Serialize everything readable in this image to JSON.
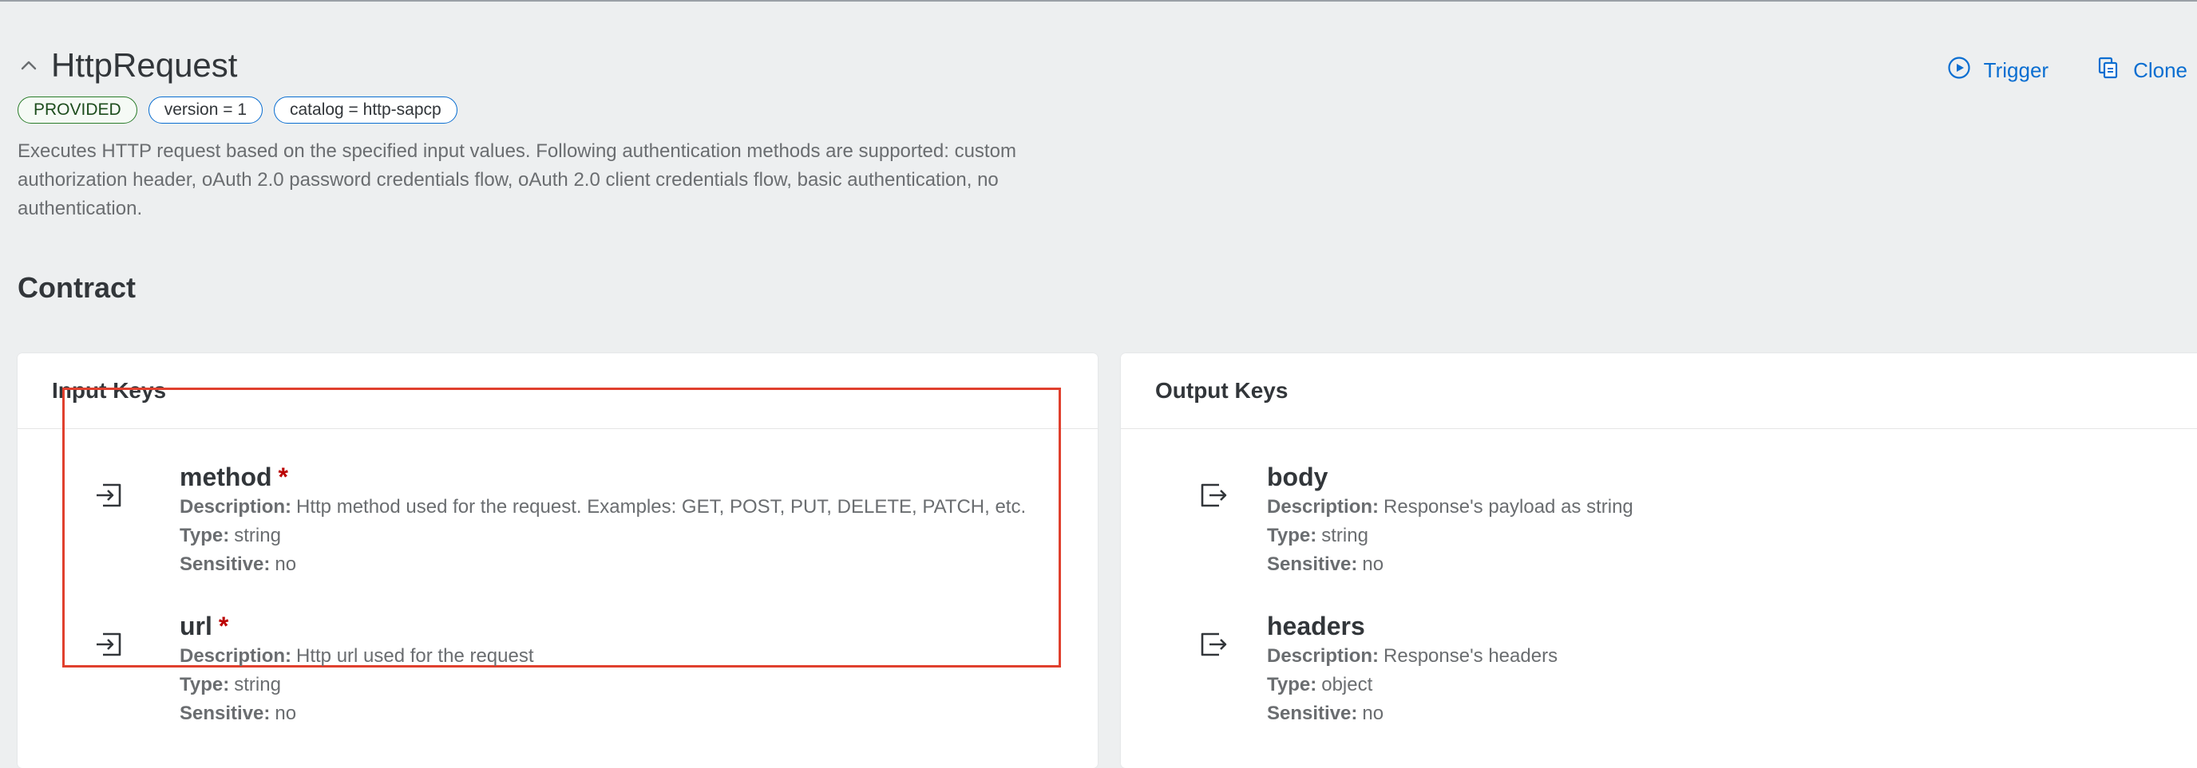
{
  "header": {
    "title": "HttpRequest",
    "badges": {
      "status": "PROVIDED",
      "version": "version = 1",
      "catalog": "catalog = http-sapcp"
    },
    "description": "Executes HTTP request based on the specified input values. Following authentication methods are supported: custom authorization header, oAuth 2.0 password credentials flow, oAuth 2.0 client credentials flow, basic authentication, no authentication."
  },
  "actions": {
    "trigger": "Trigger",
    "clone": "Clone"
  },
  "contract": {
    "title": "Contract",
    "input_title": "Input Keys",
    "output_title": "Output Keys"
  },
  "labels": {
    "description": "Description:",
    "type": "Type:",
    "sensitive": "Sensitive:",
    "required_mark": "*"
  },
  "inputs": [
    {
      "name": "method",
      "description": "Http method used for the request. Examples: GET, POST, PUT, DELETE, PATCH, etc.",
      "type": "string",
      "sensitive": "no"
    },
    {
      "name": "url",
      "description": "Http url used for the request",
      "type": "string",
      "sensitive": "no"
    }
  ],
  "outputs": [
    {
      "name": "body",
      "description": "Response's payload as string",
      "type": "string",
      "sensitive": "no"
    },
    {
      "name": "headers",
      "description": "Response's headers",
      "type": "object",
      "sensitive": "no"
    }
  ],
  "colors": {
    "accent": "#0a6ed1",
    "required": "#bb0000",
    "highlight": "#e0402e",
    "provided": "#2b7d2b"
  }
}
